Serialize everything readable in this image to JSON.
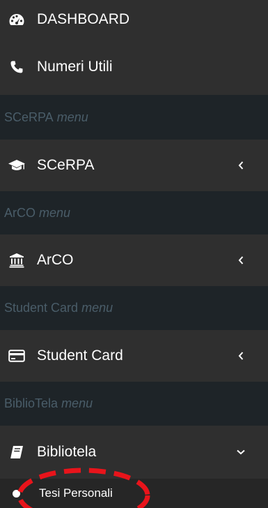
{
  "menu": {
    "dashboard": {
      "label": "DASHBOARD",
      "icon": "dashboard-gauge-icon"
    },
    "numeri_utili": {
      "label": "Numeri Utili",
      "icon": "phone-icon"
    },
    "scerpa_header": {
      "prefix": "SCeRPA",
      "suffix": "menu"
    },
    "scerpa": {
      "label": "SCeRPA",
      "icon": "graduation-cap-icon"
    },
    "arco_header": {
      "prefix": "ArCO",
      "suffix": "menu"
    },
    "arco": {
      "label": "ArCO",
      "icon": "institution-icon"
    },
    "student_card_header": {
      "prefix": "Student Card",
      "suffix": "menu"
    },
    "student_card": {
      "label": "Student Card",
      "icon": "credit-card-icon"
    },
    "bibliotela_header": {
      "prefix": "BiblioTela",
      "suffix": "menu"
    },
    "bibliotela": {
      "label": "Bibliotela",
      "icon": "book-icon",
      "expanded": true
    },
    "tesi_personali": {
      "label": "Tesi Personali",
      "icon": "circle-bullet-icon"
    }
  },
  "colors": {
    "item_bg": "#2f2f2f",
    "header_bg": "#1e2428",
    "header_text": "#4a5d69",
    "highlight_circle": "#e8141b"
  }
}
